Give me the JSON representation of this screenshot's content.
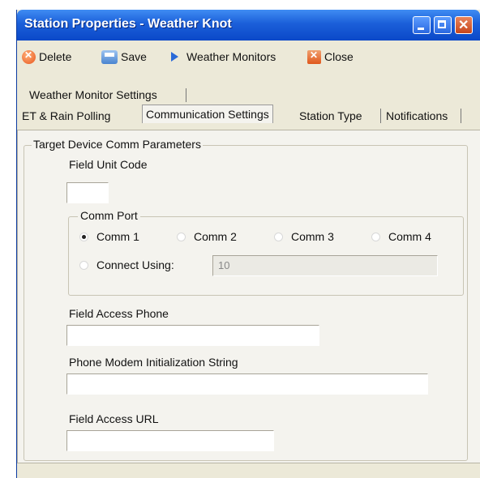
{
  "window": {
    "title": "Station Properties - Weather Knot"
  },
  "toolbar": {
    "delete_label": "Delete",
    "save_label": "Save",
    "weather_monitors_label": "Weather Monitors",
    "close_label": "Close"
  },
  "tabs": {
    "row1": [
      "Weather Monitor Settings"
    ],
    "row2": [
      "ET & Rain Polling",
      "Communication Settings",
      "Station Type",
      "Notifications"
    ],
    "active": "Communication Settings"
  },
  "comm": {
    "group_title": "Target Device Comm Parameters",
    "field_unit_code_label": "Field Unit Code",
    "field_unit_code_value": "",
    "comm_port": {
      "title": "Comm Port",
      "options": [
        "Comm 1",
        "Comm 2",
        "Comm 3",
        "Comm 4"
      ],
      "selected": "Comm 1",
      "connect_using_label": "Connect Using:",
      "connect_using_value": "10"
    },
    "field_access_phone_label": "Field Access Phone",
    "field_access_phone_value": "",
    "modem_init_label": "Phone Modem Initialization String",
    "modem_init_value": "",
    "field_access_url_label": "Field Access URL",
    "field_access_url_value": ""
  },
  "icons": {
    "delete": "delete-icon",
    "save": "save-icon",
    "weather_monitors": "play-arrow-icon",
    "close": "close-icon"
  },
  "colors": {
    "titlebar": "#1b5fd9",
    "panel": "#f4f3ee",
    "window": "#ece9d8"
  }
}
